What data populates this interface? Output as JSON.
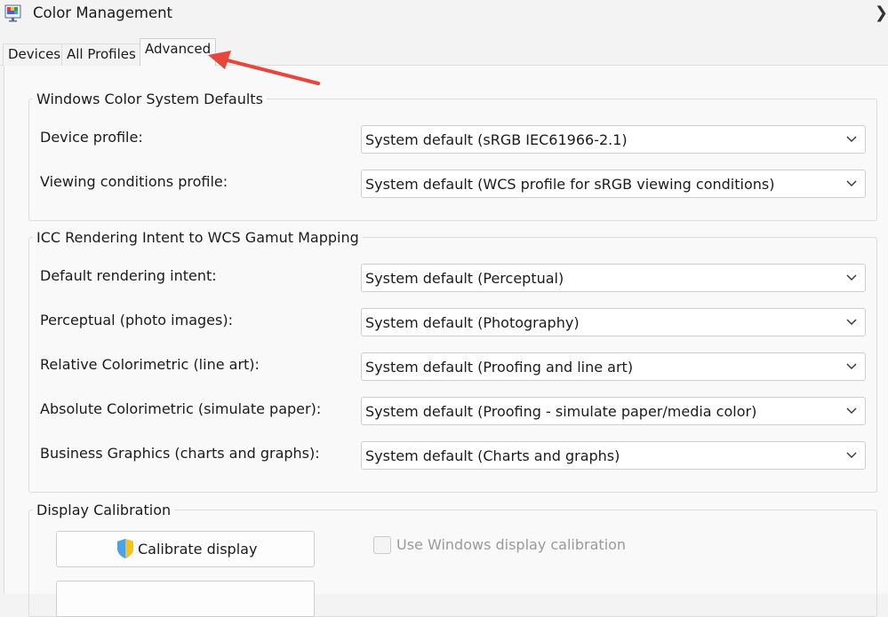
{
  "window": {
    "title": "Color Management",
    "close_glyph": "❯"
  },
  "tabs": [
    {
      "label": "Devices",
      "selected": false
    },
    {
      "label": "All Profiles",
      "selected": false
    },
    {
      "label": "Advanced",
      "selected": true
    }
  ],
  "wcs_defaults": {
    "legend": "Windows Color System Defaults",
    "rows": [
      {
        "label": "Device profile:",
        "value": "System default (sRGB IEC61966-2.1)"
      },
      {
        "label": "Viewing conditions profile:",
        "value": "System default (WCS profile for sRGB viewing conditions)"
      }
    ]
  },
  "icc_mapping": {
    "legend": "ICC Rendering Intent to WCS Gamut Mapping",
    "rows": [
      {
        "label": "Default rendering intent:",
        "value": "System default (Perceptual)"
      },
      {
        "label": "Perceptual (photo images):",
        "value": "System default (Photography)"
      },
      {
        "label": "Relative Colorimetric (line art):",
        "value": "System default (Proofing and line art)"
      },
      {
        "label": "Absolute Colorimetric (simulate paper):",
        "value": "System default (Proofing - simulate paper/media color)"
      },
      {
        "label": "Business Graphics (charts and graphs):",
        "value": "System default (Charts and graphs)"
      }
    ]
  },
  "display_calibration": {
    "legend": "Display Calibration",
    "calibrate_button": "Calibrate display",
    "use_windows_calibration_label": "Use Windows display calibration",
    "use_windows_calibration_checked": false,
    "use_windows_calibration_enabled": false
  },
  "colors": {
    "annotation_arrow": "#e8453c",
    "window_bg": "#f3f3f3",
    "panel_bg": "#f9f9f9"
  },
  "icons": {
    "app": "color-management-icon",
    "shield": "uac-shield-icon",
    "dropdown": "chevron-down-icon"
  }
}
